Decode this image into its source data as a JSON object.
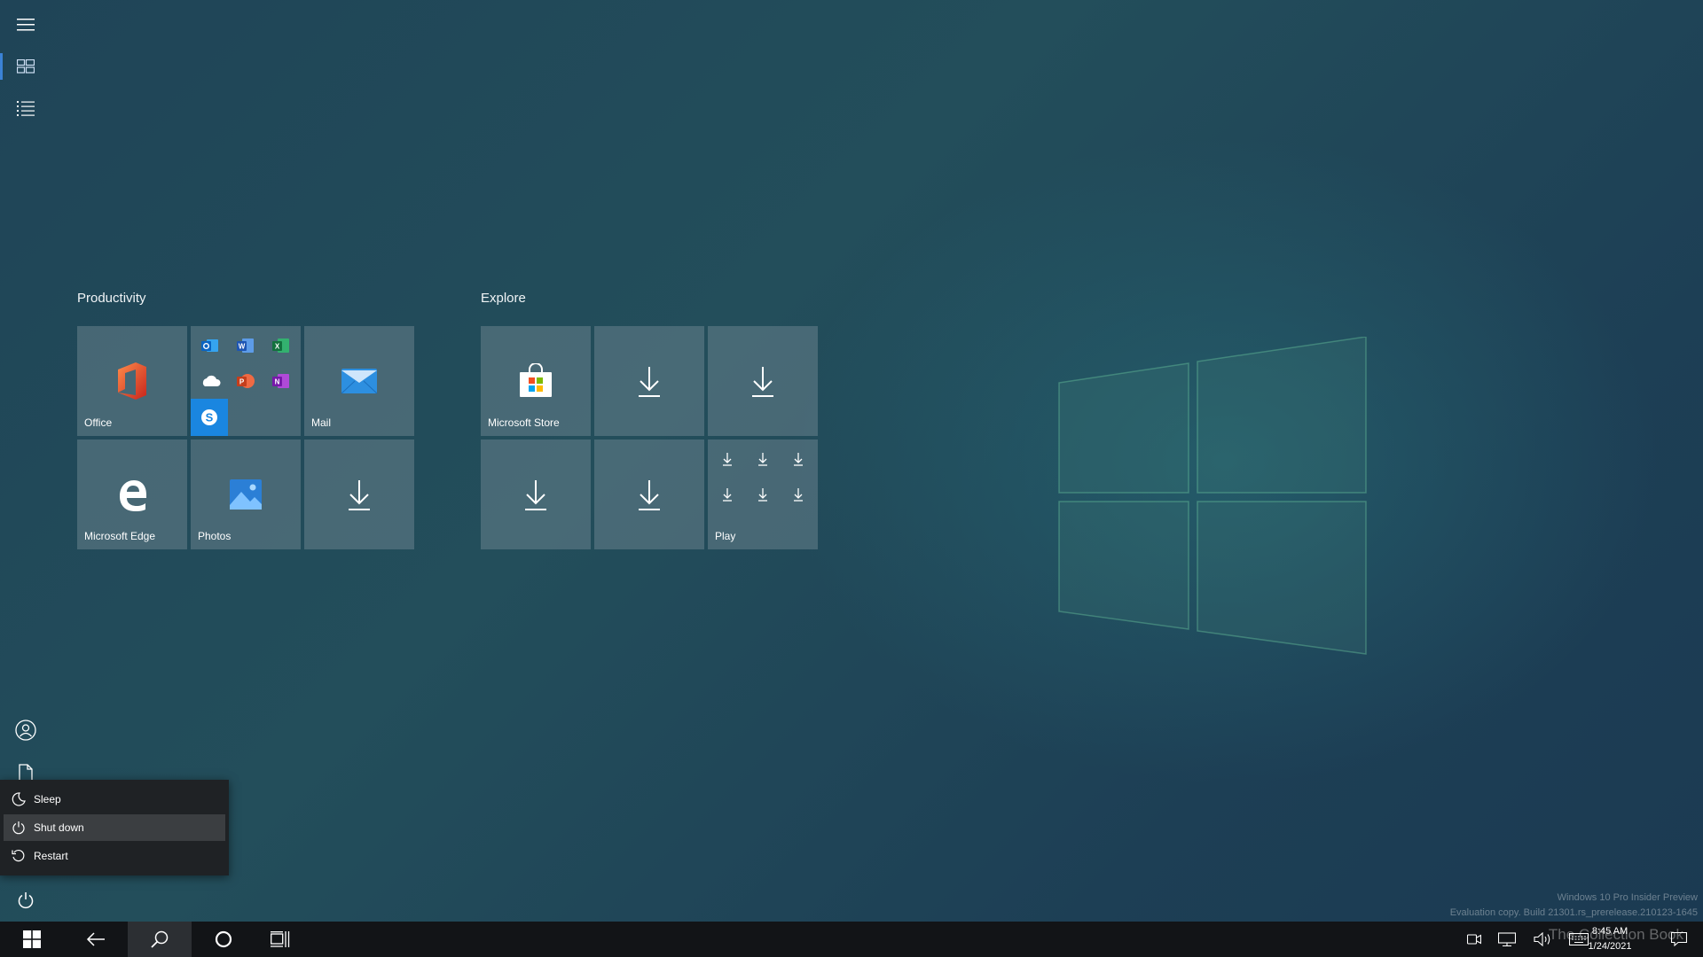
{
  "start": {
    "groups": [
      {
        "title": "Productivity",
        "tiles": [
          {
            "label": "Office",
            "icon": "office-icon"
          },
          {
            "label": "",
            "icon": "office-apps-folder-icon"
          },
          {
            "label": "Mail",
            "icon": "mail-icon"
          },
          {
            "label": "Microsoft Edge",
            "icon": "edge-icon"
          },
          {
            "label": "Photos",
            "icon": "photos-icon"
          },
          {
            "label": "",
            "icon": "download-icon"
          }
        ]
      },
      {
        "title": "Explore",
        "tiles": [
          {
            "label": "Microsoft Store",
            "icon": "store-icon"
          },
          {
            "label": "",
            "icon": "download-icon"
          },
          {
            "label": "",
            "icon": "download-icon"
          },
          {
            "label": "",
            "icon": "download-icon"
          },
          {
            "label": "",
            "icon": "download-icon"
          },
          {
            "label": "Play",
            "icon": "play-folder-icon"
          }
        ]
      }
    ]
  },
  "rail": {
    "icons": [
      "hamburger-menu-icon",
      "pinned-tiles-icon",
      "all-apps-list-icon",
      "user-account-icon",
      "documents-icon",
      "power-icon"
    ]
  },
  "power_menu": {
    "items": [
      {
        "label": "Sleep",
        "icon": "sleep-moon-icon"
      },
      {
        "label": "Shut down",
        "icon": "shutdown-icon"
      },
      {
        "label": "Restart",
        "icon": "restart-icon"
      }
    ],
    "highlighted": "Shut down"
  },
  "taskbar": {
    "buttons": [
      "windows-start-icon",
      "back-arrow-icon",
      "search-icon",
      "cortana-icon",
      "task-view-icon"
    ],
    "tray_icons": [
      "meet-now-icon",
      "network-icon",
      "volume-icon",
      "keyboard-icon",
      "action-center-icon"
    ],
    "time": "8:45 AM",
    "date": "1/24/2021"
  },
  "watermark": {
    "line1": "Windows 10 Pro Insider Preview",
    "line2": "Evaluation copy. Build 21301.rs_prerelease.210123-1645",
    "overlay": "The Collection Book"
  },
  "colors": {
    "accent": "#3b82d6",
    "tile_bg": "#5f7d88",
    "taskbar_bg": "#121417",
    "menu_bg": "#1f2225"
  }
}
